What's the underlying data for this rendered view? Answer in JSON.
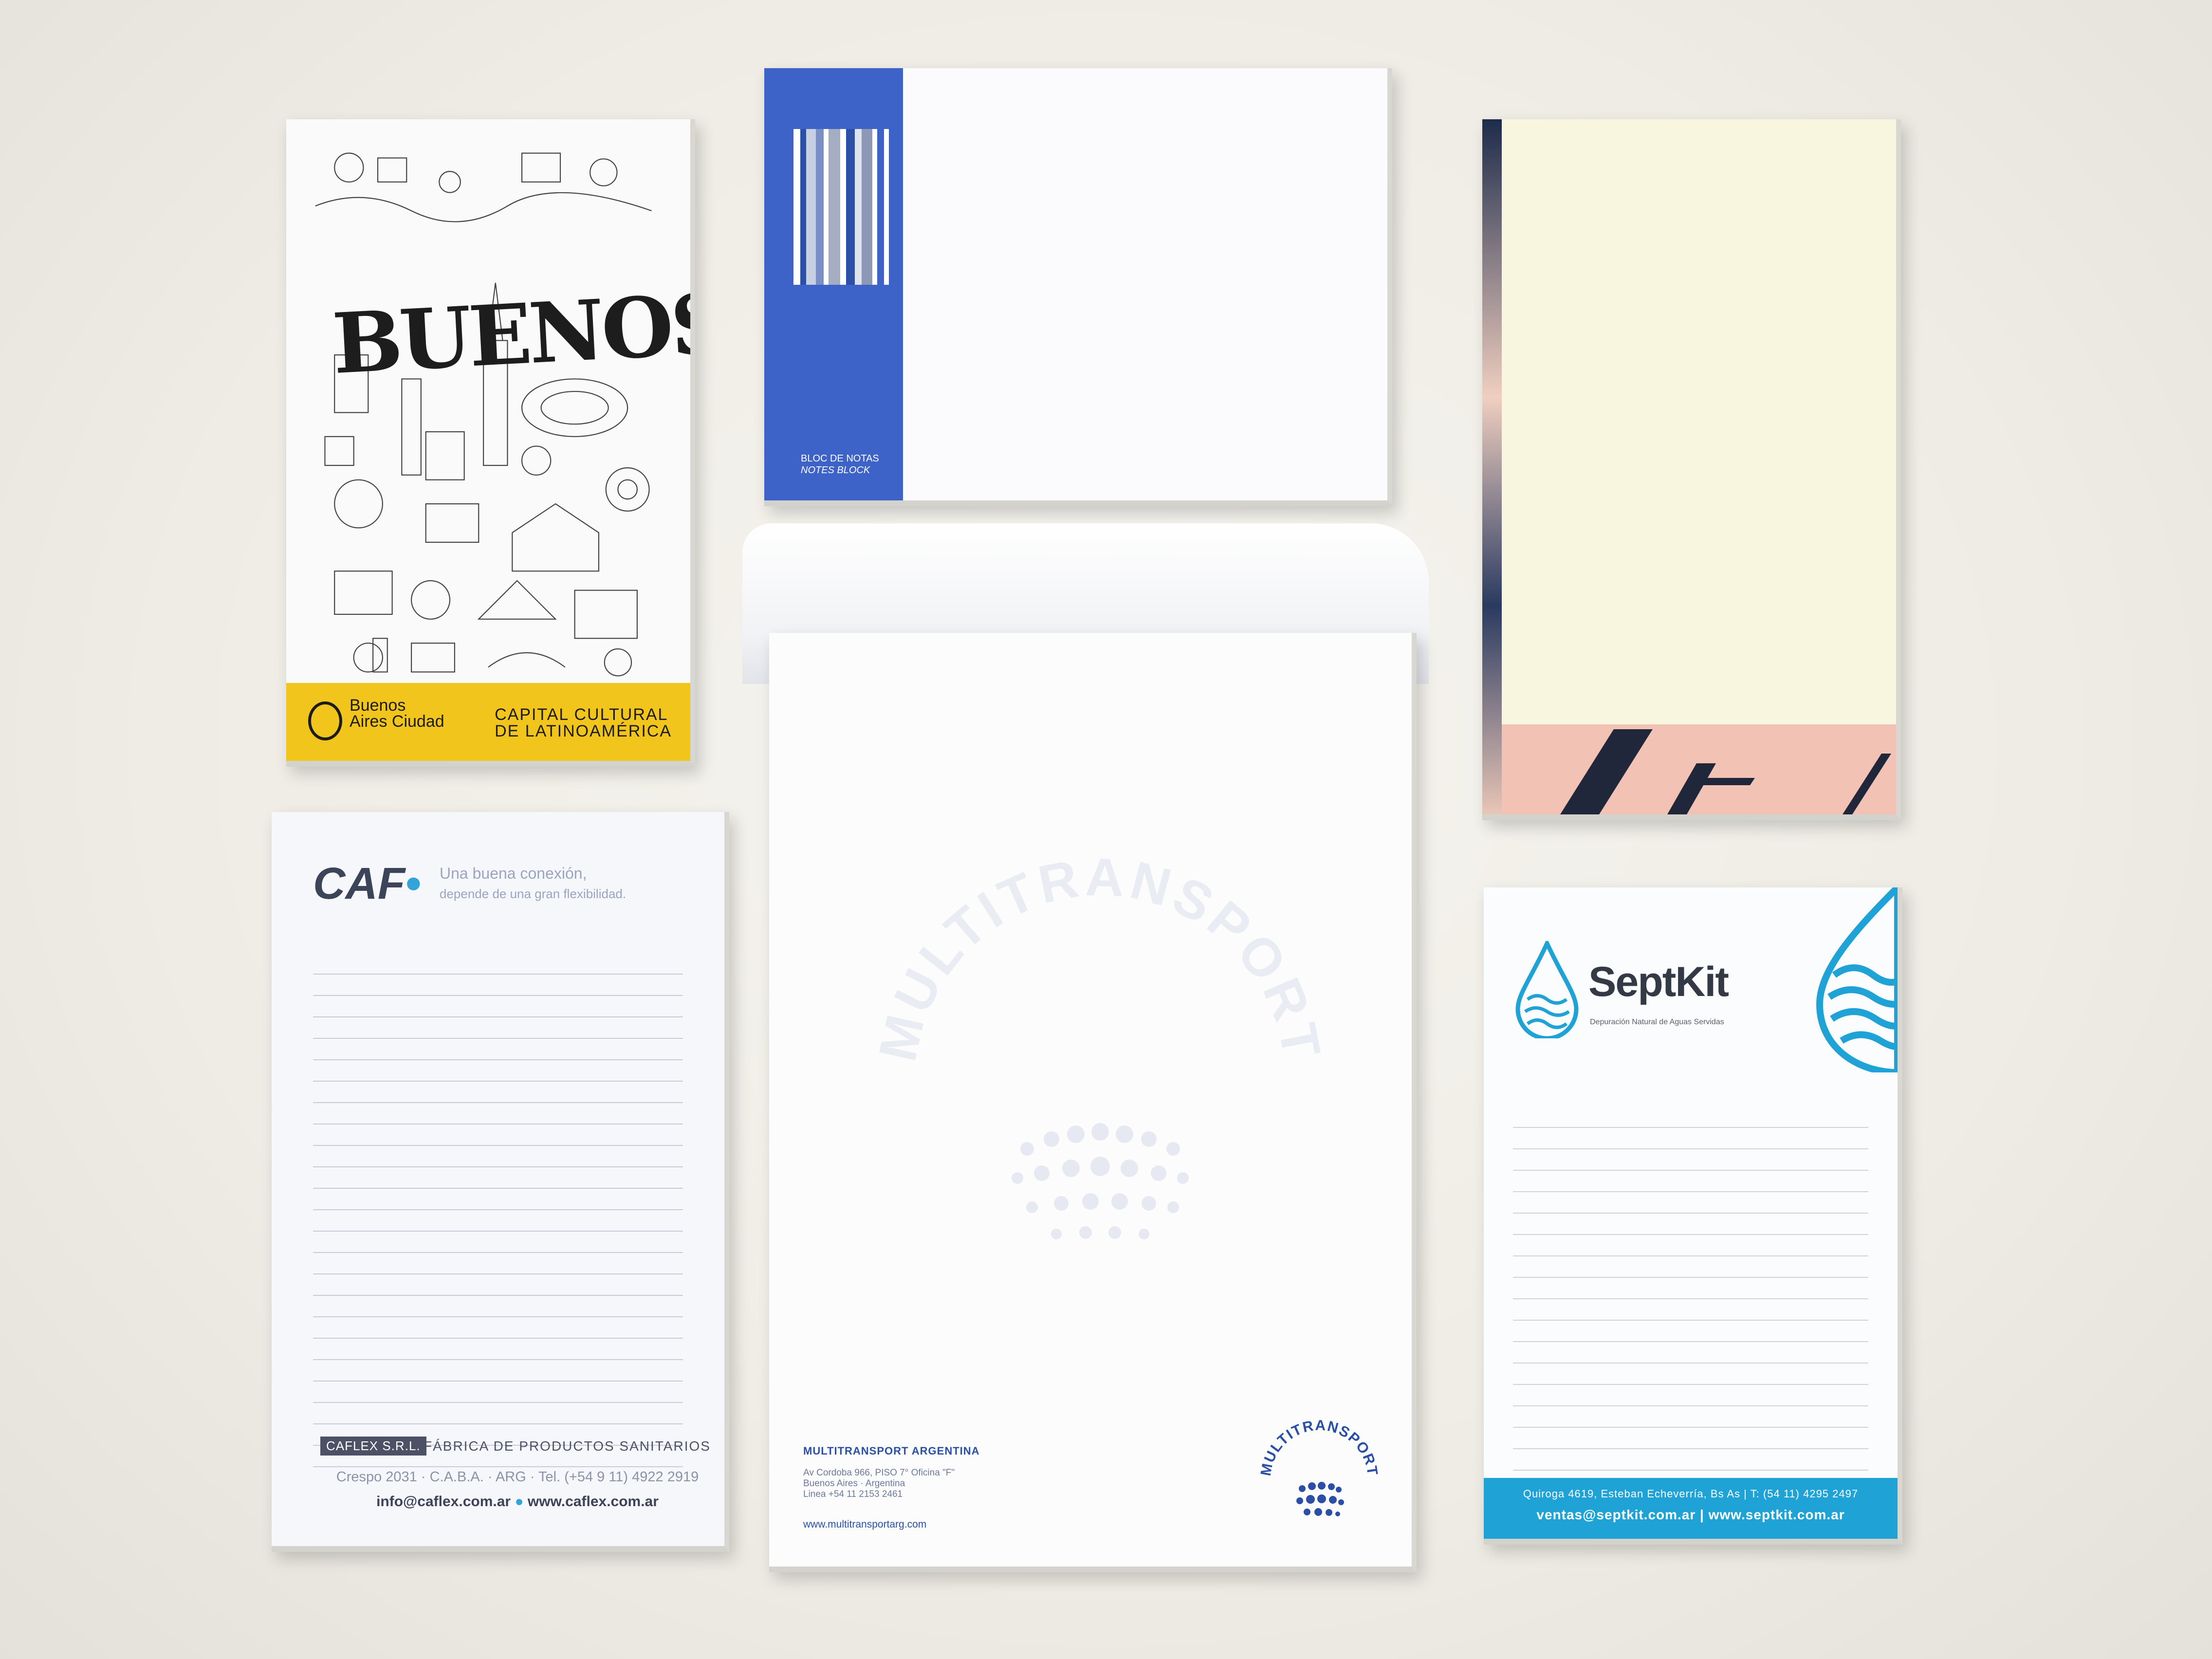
{
  "pads": {
    "buenos_aires": {
      "title": "BUENOSAIRES",
      "city_logo": "Buenos Aires Ciudad",
      "tagline_1": "CAPITAL CULTURAL",
      "tagline_2": "DE LATINOAMÉRICA",
      "band_color": "#f2c51c"
    },
    "bloc_de_notas": {
      "label_1": "BLOC DE NOTAS",
      "label_2": "NOTES BLOCK",
      "side_color": "#3e63c8"
    },
    "caflex": {
      "logo": "CAF",
      "slogan_1": "Una buena conexión,",
      "slogan_2": "depende de una gran flexibilidad.",
      "badge": "CAFLEX S.R.L.",
      "subtitle": "FÁBRICA DE PRODUCTOS SANITARIOS",
      "address": "Crespo 2031 · C.A.B.A. · ARG · Tel. (+54 9 11) 4922 2919",
      "email": "info@caflex.com.ar",
      "web": "www.caflex.com.ar"
    },
    "multitransport": {
      "watermark": "MULTITRANSPORT",
      "company": "MULTITRANSPORT ARGENTINA",
      "address_1": "Av Cordoba 966, PISO 7° Oficina \"F\"",
      "address_2": "Buenos Aires · Argentina",
      "address_3": "Linea +54 11 2153 2461",
      "web": "www.multitransportarg.com",
      "emblem_text": "MULTITRANSPORT"
    },
    "septkit": {
      "brand": "SeptKit",
      "tagline": "Depuración Natural de Aguas Servidas",
      "footer_1": "Quiroga 4619, Esteban Echeverría, Bs As  |  T: (54 11) 4295 2497",
      "footer_2": "ventas@septkit.com.ar  |  www.septkit.com.ar",
      "accent_color": "#1fa2d6"
    }
  }
}
